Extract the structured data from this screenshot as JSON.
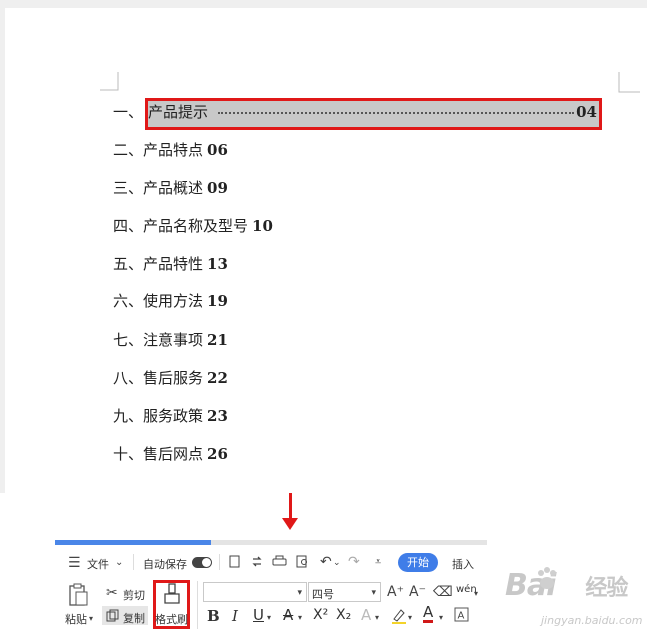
{
  "toc": {
    "items": [
      {
        "prefix": "一、",
        "label": "产品提示",
        "page": "04"
      },
      {
        "prefix": "二、",
        "label": "产品特点",
        "page": "06"
      },
      {
        "prefix": "三、",
        "label": "产品概述",
        "page": "09"
      },
      {
        "prefix": "四、",
        "label": "产品名称及型号",
        "page": "10"
      },
      {
        "prefix": "五、",
        "label": "产品特性",
        "page": "13"
      },
      {
        "prefix": "六、",
        "label": "使用方法",
        "page": "19"
      },
      {
        "prefix": "七、",
        "label": "注意事项",
        "page": "21"
      },
      {
        "prefix": "八、",
        "label": "售后服务",
        "page": "22"
      },
      {
        "prefix": "九、",
        "label": "服务政策",
        "page": "23"
      },
      {
        "prefix": "十、",
        "label": "售后网点",
        "page": "26"
      }
    ]
  },
  "toolbar": {
    "menu_label": "文件",
    "autosave_label": "自动保存",
    "autosave_on": true,
    "start_tab": "开始",
    "insert_tab": "插入",
    "paste_label": "粘贴",
    "cut_label": "剪切",
    "copy_label": "复制",
    "format_painter_label": "格式刷",
    "font_name_value": "",
    "font_size_value": "四号",
    "wen_label": "wén"
  },
  "progress": {
    "fraction": 0.36
  },
  "watermark": {
    "brand": "Bai",
    "brand2": "经验",
    "url": "jingyan.baidu.com"
  },
  "colors": {
    "accent": "#3f7de8",
    "highlight_border": "#e01818",
    "selection": "#c8c8c8"
  }
}
